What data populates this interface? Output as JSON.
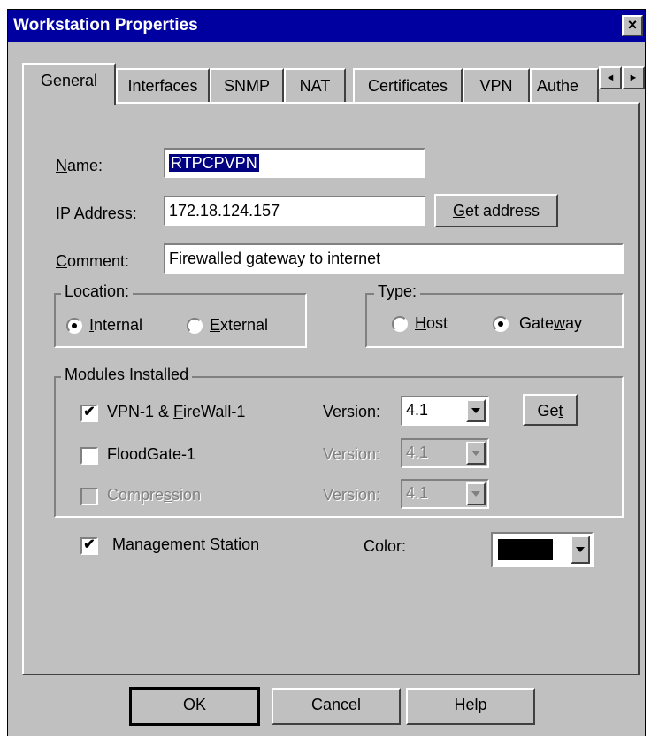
{
  "window": {
    "title": "Workstation Properties",
    "close_icon": "×"
  },
  "tabs": [
    {
      "label": "General",
      "active": true
    },
    {
      "label": "Interfaces"
    },
    {
      "label": "SNMP"
    },
    {
      "label": "NAT"
    },
    {
      "label": "Certificates"
    },
    {
      "label": "VPN"
    },
    {
      "label": "Authe"
    }
  ],
  "tab_scroll": {
    "left": "◄",
    "right": "►"
  },
  "form": {
    "name_label_u": "N",
    "name_label_rest": "ame:",
    "name_value": "RTPCPVPN",
    "ip_label_pre": "IP ",
    "ip_label_u": "A",
    "ip_label_rest": "ddress:",
    "ip_value": "172.18.124.157",
    "get_address_u": "G",
    "get_address_rest": "et address",
    "comment_label_u": "C",
    "comment_label_rest": "omment:",
    "comment_value": "Firewalled gateway to internet"
  },
  "location": {
    "legend": "Location:",
    "internal_u": "I",
    "internal_rest": "nternal",
    "external_u": "E",
    "external_rest": "xternal",
    "selected": "internal"
  },
  "type": {
    "legend": "Type:",
    "host_u": "H",
    "host_rest": "ost",
    "gateway_pre": "Gate",
    "gateway_u": "w",
    "gateway_rest": "ay",
    "selected": "gateway"
  },
  "modules": {
    "legend": "Modules Installed",
    "items": [
      {
        "label_pre": "VPN-1 & ",
        "label_u": "F",
        "label_rest": "ireWall-1",
        "checked": true,
        "version_label": "Version:",
        "version": "4.1",
        "enabled": true
      },
      {
        "label_pre": "FloodGate-1",
        "label_u": "",
        "label_rest": "",
        "checked": false,
        "version_label": "Version:",
        "version": "4.1",
        "enabled": false
      },
      {
        "label_pre": "Compre",
        "label_u": "s",
        "label_rest": "sion",
        "checked": false,
        "version_label": "Version:",
        "version": "4.1",
        "enabled": false
      }
    ],
    "get_pre": "Ge",
    "get_u": "t"
  },
  "management": {
    "label_u": "M",
    "label_rest": "anagement Station",
    "checked": true
  },
  "color": {
    "label": "Color:",
    "value": "#000000"
  },
  "buttons": {
    "ok": "OK",
    "cancel": "Cancel",
    "help": "Help"
  },
  "icons": {
    "check": "✔",
    "dropdown": "dropdown-arrow-icon"
  }
}
